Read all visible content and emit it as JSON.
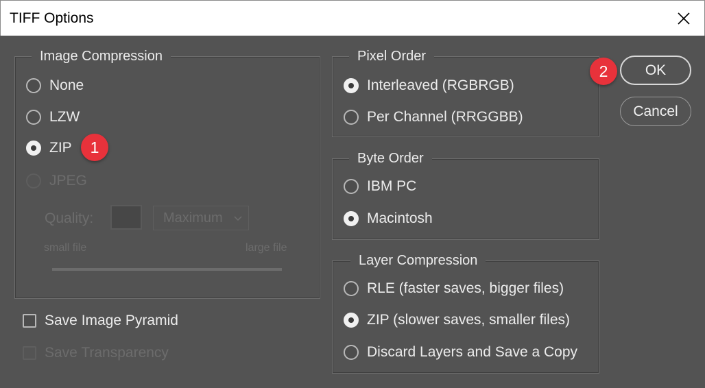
{
  "window": {
    "title": "TIFF Options",
    "close_icon": "close-icon"
  },
  "image_compression": {
    "legend": "Image Compression",
    "options": [
      {
        "label": "None",
        "checked": false,
        "disabled": false
      },
      {
        "label": "LZW",
        "checked": false,
        "disabled": false
      },
      {
        "label": "ZIP",
        "checked": true,
        "disabled": false
      },
      {
        "label": "JPEG",
        "checked": false,
        "disabled": true
      }
    ],
    "quality_label": "Quality:",
    "quality_value": "",
    "quality_select": "Maximum",
    "small_file_label": "small file",
    "large_file_label": "large file"
  },
  "pixel_order": {
    "legend": "Pixel Order",
    "options": [
      {
        "label": "Interleaved (RGBRGB)",
        "checked": true
      },
      {
        "label": "Per Channel (RRGGBB)",
        "checked": false
      }
    ]
  },
  "byte_order": {
    "legend": "Byte Order",
    "options": [
      {
        "label": "IBM PC",
        "checked": false
      },
      {
        "label": "Macintosh",
        "checked": true
      }
    ]
  },
  "layer_compression": {
    "legend": "Layer Compression",
    "options": [
      {
        "label": "RLE (faster saves, bigger files)",
        "checked": false
      },
      {
        "label": "ZIP (slower saves, smaller files)",
        "checked": true
      },
      {
        "label": "Discard Layers and Save a Copy",
        "checked": false
      }
    ]
  },
  "checkboxes": {
    "save_image_pyramid": {
      "label": "Save Image Pyramid",
      "checked": false,
      "disabled": false
    },
    "save_transparency": {
      "label": "Save Transparency",
      "checked": false,
      "disabled": true
    }
  },
  "buttons": {
    "ok": "OK",
    "cancel": "Cancel"
  },
  "annotations": {
    "badge_1": "1",
    "badge_2": "2",
    "badge_color": "#e8323b"
  },
  "colors": {
    "dialog_bg": "#535353",
    "titlebar_bg": "#ffffff",
    "text": "#ececec",
    "disabled_text": "#6c6c6c"
  }
}
